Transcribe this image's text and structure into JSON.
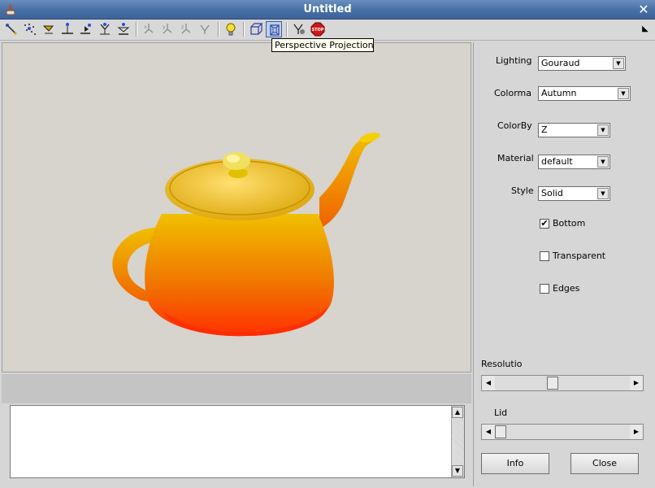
{
  "window": {
    "title": "Untitled",
    "close_glyph": "✕",
    "menu_glyph": "◣"
  },
  "toolbar": {
    "icons": [
      "rotate-tool-icon",
      "scatter-tool-icon",
      "pan-tool-icon",
      "measure-tool-icon",
      "pick-tool-icon",
      "select-tool-icon",
      "probe-tool-icon",
      "view-x-icon",
      "view-y-icon",
      "view-z-icon",
      "view-reset-icon",
      "light-bulb-icon",
      "orthographic-projection-icon",
      "perspective-projection-icon",
      "settings-icon",
      "stop-icon"
    ]
  },
  "tooltip": "Perspective Projection",
  "panel": {
    "lighting": {
      "label": "Lighting",
      "value": "Gouraud"
    },
    "colormap": {
      "label": "Colorma",
      "value": "Autumn"
    },
    "colorby": {
      "label": "ColorBy",
      "value": "Z"
    },
    "material": {
      "label": "Material",
      "value": "default"
    },
    "style": {
      "label": "Style",
      "value": "Solid"
    },
    "bottom": {
      "label": "Bottom",
      "checked": true,
      "mark": "✔"
    },
    "transparent": {
      "label": "Transparent",
      "checked": false
    },
    "edges": {
      "label": "Edges",
      "checked": false
    },
    "resolution": {
      "label": "Resolutio",
      "level": 0.42
    },
    "lid": {
      "label": "Lid",
      "level": 0.0
    },
    "info_button": "Info",
    "close_button": "Close"
  },
  "colors": {
    "teapot_top": "#f0c000",
    "teapot_bottom": "#ff3000",
    "viewport_bg": "#d7d3cd"
  }
}
